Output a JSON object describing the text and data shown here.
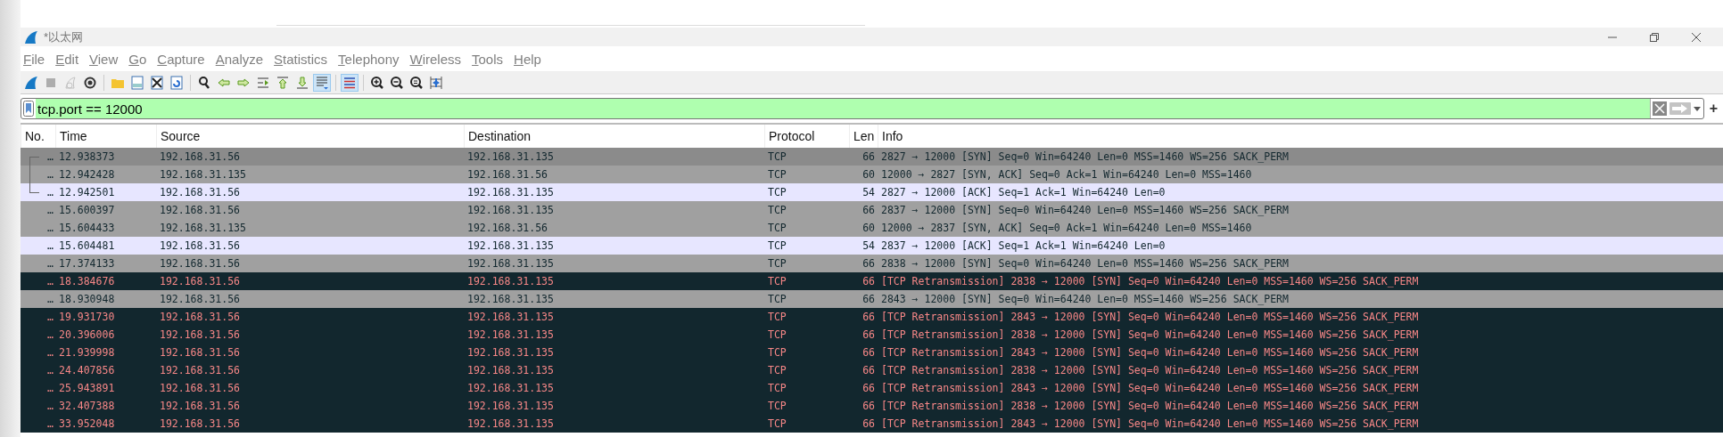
{
  "window": {
    "title": "*以太网"
  },
  "menu": [
    {
      "label": "File"
    },
    {
      "label": "Edit"
    },
    {
      "label": "View"
    },
    {
      "label": "Go"
    },
    {
      "label": "Capture"
    },
    {
      "label": "Analyze"
    },
    {
      "label": "Statistics"
    },
    {
      "label": "Telephony"
    },
    {
      "label": "Wireless"
    },
    {
      "label": "Tools"
    },
    {
      "label": "Help"
    }
  ],
  "toolbar": [
    {
      "kind": "fin",
      "pressed": false,
      "disabled": false
    },
    {
      "kind": "stop",
      "pressed": false,
      "disabled": true
    },
    {
      "kind": "restart",
      "pressed": false,
      "disabled": true
    },
    {
      "kind": "gear",
      "pressed": false,
      "disabled": false
    },
    {
      "kind": "sep"
    },
    {
      "kind": "folder",
      "pressed": false,
      "disabled": false
    },
    {
      "kind": "save",
      "pressed": false,
      "disabled": false
    },
    {
      "kind": "close",
      "pressed": false,
      "disabled": false
    },
    {
      "kind": "reload",
      "pressed": false,
      "disabled": false
    },
    {
      "kind": "sep"
    },
    {
      "kind": "find",
      "pressed": false,
      "disabled": false
    },
    {
      "kind": "back",
      "pressed": false,
      "disabled": false
    },
    {
      "kind": "forward",
      "pressed": false,
      "disabled": false
    },
    {
      "kind": "goto",
      "pressed": false,
      "disabled": false
    },
    {
      "kind": "first",
      "pressed": false,
      "disabled": false
    },
    {
      "kind": "last",
      "pressed": false,
      "disabled": false
    },
    {
      "kind": "autoscroll",
      "pressed": true,
      "disabled": false
    },
    {
      "kind": "sep"
    },
    {
      "kind": "colorize",
      "pressed": true,
      "disabled": false
    },
    {
      "kind": "sep"
    },
    {
      "kind": "zoomin",
      "pressed": false,
      "disabled": false
    },
    {
      "kind": "zoomout",
      "pressed": false,
      "disabled": false
    },
    {
      "kind": "zoomreset",
      "pressed": false,
      "disabled": false
    },
    {
      "kind": "resize",
      "pressed": false,
      "disabled": false
    }
  ],
  "filter": {
    "value": "tcp.port == 12000",
    "valid": true,
    "add_label": "+"
  },
  "table": {
    "columns": [
      "No.",
      "Time",
      "Source",
      "Destination",
      "Protocol",
      "Len",
      "Info"
    ],
    "rows": [
      {
        "kind": "syn",
        "highlighted": true,
        "related": true,
        "no": "…",
        "time": "12.938373",
        "source": "192.168.31.56",
        "destination": "192.168.31.135",
        "protocol": "TCP",
        "length": "66",
        "info": "2827 → 12000 [SYN] Seq=0 Win=64240 Len=0 MSS=1460 WS=256 SACK_PERM"
      },
      {
        "kind": "syn",
        "highlighted": false,
        "related": true,
        "no": "…",
        "time": "12.942428",
        "source": "192.168.31.135",
        "destination": "192.168.31.56",
        "protocol": "TCP",
        "length": "60",
        "info": "12000 → 2827 [SYN, ACK] Seq=0 Ack=1 Win=64240 Len=0 MSS=1460"
      },
      {
        "kind": "ack",
        "highlighted": false,
        "related": true,
        "no": "…",
        "time": "12.942501",
        "source": "192.168.31.56",
        "destination": "192.168.31.135",
        "protocol": "TCP",
        "length": "54",
        "info": "2827 → 12000 [ACK] Seq=1 Ack=1 Win=64240 Len=0"
      },
      {
        "kind": "syn",
        "highlighted": false,
        "no": "…",
        "time": "15.600397",
        "source": "192.168.31.56",
        "destination": "192.168.31.135",
        "protocol": "TCP",
        "length": "66",
        "info": "2837 → 12000 [SYN] Seq=0 Win=64240 Len=0 MSS=1460 WS=256 SACK_PERM"
      },
      {
        "kind": "syn",
        "highlighted": false,
        "no": "…",
        "time": "15.604433",
        "source": "192.168.31.135",
        "destination": "192.168.31.56",
        "protocol": "TCP",
        "length": "60",
        "info": "12000 → 2837 [SYN, ACK] Seq=0 Ack=1 Win=64240 Len=0 MSS=1460"
      },
      {
        "kind": "ack",
        "highlighted": false,
        "no": "…",
        "time": "15.604481",
        "source": "192.168.31.56",
        "destination": "192.168.31.135",
        "protocol": "TCP",
        "length": "54",
        "info": "2837 → 12000 [ACK] Seq=1 Ack=1 Win=64240 Len=0"
      },
      {
        "kind": "syn",
        "highlighted": false,
        "no": "…",
        "time": "17.374133",
        "source": "192.168.31.56",
        "destination": "192.168.31.135",
        "protocol": "TCP",
        "length": "66",
        "info": "2838 → 12000 [SYN] Seq=0 Win=64240 Len=0 MSS=1460 WS=256 SACK_PERM"
      },
      {
        "kind": "bad",
        "highlighted": false,
        "no": "…",
        "time": "18.384676",
        "source": "192.168.31.56",
        "destination": "192.168.31.135",
        "protocol": "TCP",
        "length": "66",
        "info": "[TCP Retransmission] 2838 → 12000 [SYN] Seq=0 Win=64240 Len=0 MSS=1460 WS=256 SACK_PERM"
      },
      {
        "kind": "syn",
        "highlighted": false,
        "no": "…",
        "time": "18.930948",
        "source": "192.168.31.56",
        "destination": "192.168.31.135",
        "protocol": "TCP",
        "length": "66",
        "info": "2843 → 12000 [SYN] Seq=0 Win=64240 Len=0 MSS=1460 WS=256 SACK_PERM"
      },
      {
        "kind": "bad",
        "highlighted": false,
        "no": "…",
        "time": "19.931730",
        "source": "192.168.31.56",
        "destination": "192.168.31.135",
        "protocol": "TCP",
        "length": "66",
        "info": "[TCP Retransmission] 2843 → 12000 [SYN] Seq=0 Win=64240 Len=0 MSS=1460 WS=256 SACK_PERM"
      },
      {
        "kind": "bad",
        "highlighted": false,
        "no": "…",
        "time": "20.396006",
        "source": "192.168.31.56",
        "destination": "192.168.31.135",
        "protocol": "TCP",
        "length": "66",
        "info": "[TCP Retransmission] 2838 → 12000 [SYN] Seq=0 Win=64240 Len=0 MSS=1460 WS=256 SACK_PERM"
      },
      {
        "kind": "bad",
        "highlighted": false,
        "no": "…",
        "time": "21.939998",
        "source": "192.168.31.56",
        "destination": "192.168.31.135",
        "protocol": "TCP",
        "length": "66",
        "info": "[TCP Retransmission] 2843 → 12000 [SYN] Seq=0 Win=64240 Len=0 MSS=1460 WS=256 SACK_PERM"
      },
      {
        "kind": "bad",
        "highlighted": false,
        "no": "…",
        "time": "24.407856",
        "source": "192.168.31.56",
        "destination": "192.168.31.135",
        "protocol": "TCP",
        "length": "66",
        "info": "[TCP Retransmission] 2838 → 12000 [SYN] Seq=0 Win=64240 Len=0 MSS=1460 WS=256 SACK_PERM"
      },
      {
        "kind": "bad",
        "highlighted": false,
        "no": "…",
        "time": "25.943891",
        "source": "192.168.31.56",
        "destination": "192.168.31.135",
        "protocol": "TCP",
        "length": "66",
        "info": "[TCP Retransmission] 2843 → 12000 [SYN] Seq=0 Win=64240 Len=0 MSS=1460 WS=256 SACK_PERM"
      },
      {
        "kind": "bad",
        "highlighted": false,
        "no": "…",
        "time": "32.407388",
        "source": "192.168.31.56",
        "destination": "192.168.31.135",
        "protocol": "TCP",
        "length": "66",
        "info": "[TCP Retransmission] 2838 → 12000 [SYN] Seq=0 Win=64240 Len=0 MSS=1460 WS=256 SACK_PERM"
      },
      {
        "kind": "bad",
        "highlighted": false,
        "no": "…",
        "time": "33.952048",
        "source": "192.168.31.56",
        "destination": "192.168.31.135",
        "protocol": "TCP",
        "length": "66",
        "info": "[TCP Retransmission] 2843 → 12000 [SYN] Seq=0 Win=64240 Len=0 MSS=1460 WS=256 SACK_PERM"
      }
    ]
  }
}
